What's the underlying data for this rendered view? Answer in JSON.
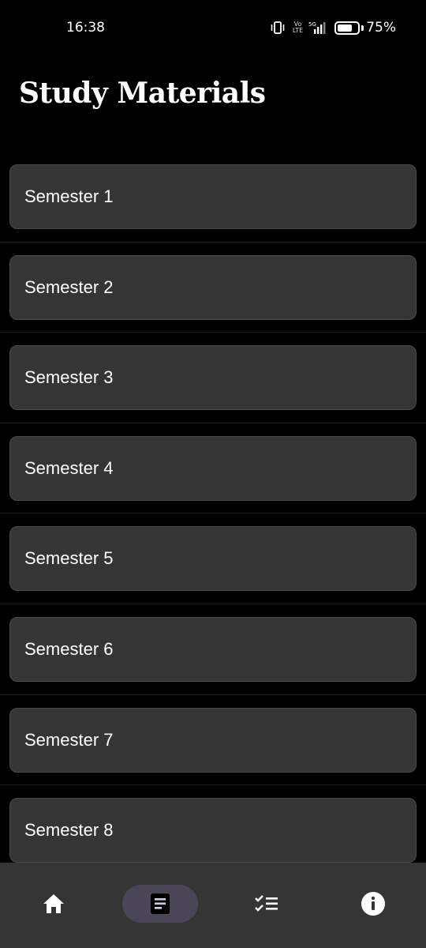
{
  "status_bar": {
    "time": "16:38",
    "volte_top": "Vo",
    "volte_bottom": "LTE",
    "network": "5G",
    "battery_percent": "75%",
    "battery_level": 0.75
  },
  "page": {
    "title": "Study Materials"
  },
  "semesters": [
    {
      "label": "Semester 1"
    },
    {
      "label": "Semester 2"
    },
    {
      "label": "Semester 3"
    },
    {
      "label": "Semester 4"
    },
    {
      "label": "Semester 5"
    },
    {
      "label": "Semester 6"
    },
    {
      "label": "Semester 7"
    },
    {
      "label": "Semester 8"
    }
  ],
  "bottom_nav": {
    "items": [
      {
        "icon": "home-icon",
        "active": false
      },
      {
        "icon": "document-icon",
        "active": true
      },
      {
        "icon": "checklist-icon",
        "active": false
      },
      {
        "icon": "info-icon",
        "active": false
      }
    ],
    "active_color": "#4a4658"
  },
  "colors": {
    "background": "#000000",
    "card": "#353535",
    "nav_bar": "#353535"
  }
}
